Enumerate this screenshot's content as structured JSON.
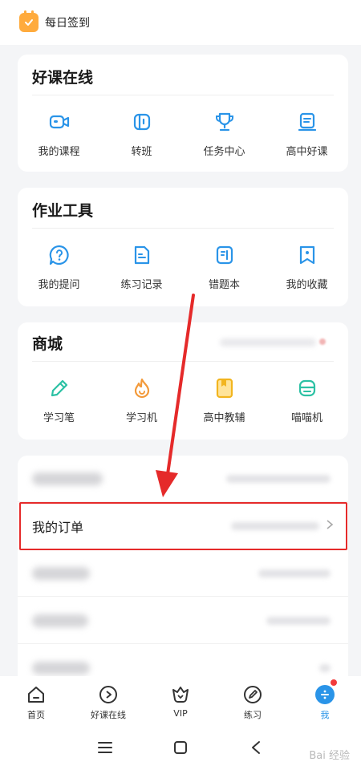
{
  "topbar": {
    "checkin_label": "每日签到"
  },
  "sections": {
    "courses": {
      "title": "好课在线",
      "items": [
        {
          "label": "我的课程",
          "icon": "camera-icon"
        },
        {
          "label": "转班",
          "icon": "switch-class-icon"
        },
        {
          "label": "任务中心",
          "icon": "trophy-icon"
        },
        {
          "label": "高中好课",
          "icon": "book-icon"
        }
      ]
    },
    "tools": {
      "title": "作业工具",
      "items": [
        {
          "label": "我的提问",
          "icon": "question-icon"
        },
        {
          "label": "练习记录",
          "icon": "record-icon"
        },
        {
          "label": "错题本",
          "icon": "wrongbook-icon"
        },
        {
          "label": "我的收藏",
          "icon": "bookmark-icon"
        }
      ]
    },
    "mall": {
      "title": "商城",
      "items": [
        {
          "label": "学习笔",
          "icon": "pen-icon"
        },
        {
          "label": "学习机",
          "icon": "flame-icon"
        },
        {
          "label": "高中教辅",
          "icon": "material-icon"
        },
        {
          "label": "喵喵机",
          "icon": "printer-icon"
        }
      ]
    }
  },
  "list": {
    "order_label": "我的订单"
  },
  "tabs": [
    {
      "label": "首页",
      "icon": "home-icon"
    },
    {
      "label": "好课在线",
      "icon": "play-icon"
    },
    {
      "label": "VIP",
      "icon": "vip-icon"
    },
    {
      "label": "练习",
      "icon": "pencil-circle-icon"
    },
    {
      "label": "我",
      "icon": "me-icon",
      "active": true
    }
  ],
  "watermark": "Bai 经验",
  "colors": {
    "accent": "#2a94e8",
    "highlight": "#e52a2a",
    "checkin": "#ffab3d"
  }
}
